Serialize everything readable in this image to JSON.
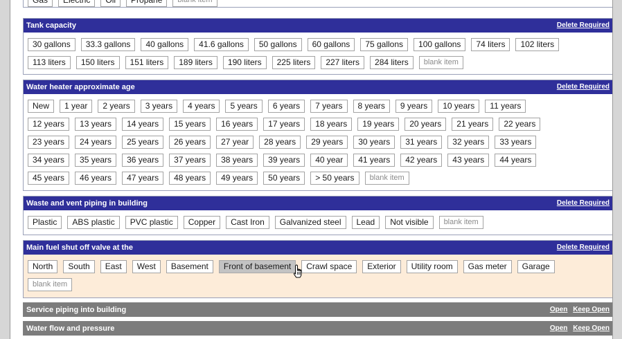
{
  "top_partial": {
    "options": [
      "Gas",
      "Electric",
      "Oil",
      "Propane",
      "blank item"
    ]
  },
  "sections": [
    {
      "title": "Tank capacity",
      "action": "Delete Required",
      "rows": [
        [
          "30 gallons",
          "33.3 gallons",
          "40 gallons",
          "41.6 gallons",
          "50 gallons",
          "60 gallons",
          "75 gallons",
          "100 gallons",
          "74 liters",
          "102 liters"
        ],
        [
          "113 liters",
          "150 liters",
          "151 liters",
          "189 liters",
          "190 liters",
          "225 liters",
          "227 liters",
          "284 liters",
          "blank item"
        ]
      ]
    },
    {
      "title": "Water heater approximate age",
      "action": "Delete Required",
      "rows": [
        [
          "New",
          "1 year",
          "2 years",
          "3 years",
          "4 years",
          "5 years",
          "6 years",
          "7 years",
          "8 years",
          "9 years",
          "10 years",
          "11 years"
        ],
        [
          "12 years",
          "13 years",
          "14 years",
          "15 years",
          "16 years",
          "17 years",
          "18 years",
          "19 years",
          "20 years",
          "21 years",
          "22 years"
        ],
        [
          "23 years",
          "24 years",
          "25 years",
          "26 years",
          "27 year",
          "28 years",
          "29 years",
          "30 years",
          "31 years",
          "32 years",
          "33 years"
        ],
        [
          "34 years",
          "35 years",
          "36 years",
          "37 years",
          "38 years",
          "39 years",
          "40 year",
          "41 years",
          "42 years",
          "43 years",
          "44 years"
        ],
        [
          "45 years",
          "46 years",
          "47 years",
          "48 years",
          "49 years",
          "50 years",
          "> 50 years",
          "blank item"
        ]
      ]
    },
    {
      "title": "Waste and vent piping in building",
      "action": "Delete Required",
      "rows": [
        [
          "Plastic",
          "ABS plastic",
          "PVC plastic",
          "Copper",
          "Cast Iron",
          "Galvanized steel",
          "Lead",
          "Not visible",
          "blank item"
        ]
      ]
    },
    {
      "title": "Main fuel shut off valve at the",
      "action": "Delete Required",
      "selected": "Front of basement",
      "rows": [
        [
          "North",
          "South",
          "East",
          "West",
          "Basement",
          "Front of basement",
          "Crawl space",
          "Exterior",
          "Utility room",
          "Gas meter",
          "Garage"
        ],
        [
          "blank item"
        ]
      ]
    }
  ],
  "collapsed": [
    {
      "title": "Service piping into building",
      "open": "Open",
      "keep_open": "Keep Open"
    },
    {
      "title": "Water flow and pressure",
      "open": "Open",
      "keep_open": "Keep Open"
    }
  ]
}
